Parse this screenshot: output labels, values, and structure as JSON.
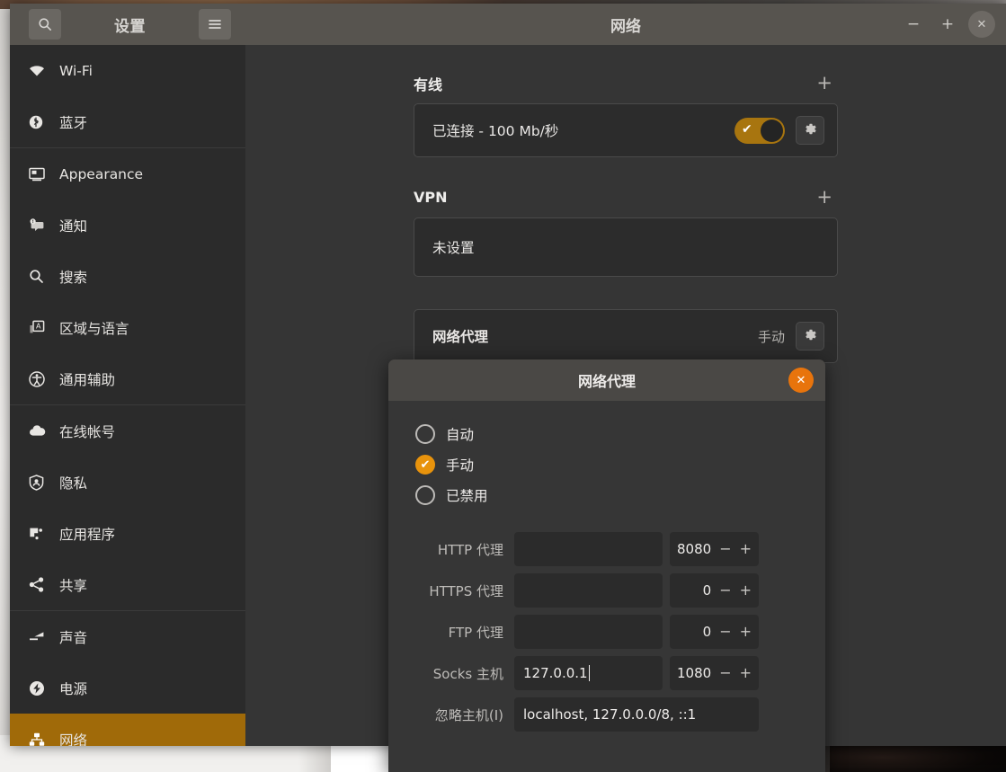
{
  "window": {
    "sidebar_title": "设置",
    "main_title": "网络",
    "search_icon": "search-icon",
    "menu_icon": "hamburger-menu-icon",
    "minimize_label": "−",
    "maximize_label": "+",
    "close_label": "✕"
  },
  "sidebar": {
    "items": [
      {
        "label": "Wi-Fi",
        "icon": "wifi-icon",
        "selected": false
      },
      {
        "label": "蓝牙",
        "icon": "bluetooth-icon",
        "selected": false
      },
      {
        "label": "Appearance",
        "icon": "appearance-icon",
        "selected": false
      },
      {
        "label": "通知",
        "icon": "notifications-icon",
        "selected": false
      },
      {
        "label": "搜索",
        "icon": "search-icon",
        "selected": false
      },
      {
        "label": "区域与语言",
        "icon": "region-language-icon",
        "selected": false
      },
      {
        "label": "通用辅助",
        "icon": "accessibility-icon",
        "selected": false
      },
      {
        "label": "在线帐号",
        "icon": "online-accounts-icon",
        "selected": false
      },
      {
        "label": "隐私",
        "icon": "privacy-icon",
        "selected": false
      },
      {
        "label": "应用程序",
        "icon": "applications-icon",
        "selected": false
      },
      {
        "label": "共享",
        "icon": "sharing-icon",
        "selected": false
      },
      {
        "label": "声音",
        "icon": "sound-icon",
        "selected": false
      },
      {
        "label": "电源",
        "icon": "power-icon",
        "selected": false
      },
      {
        "label": "网络",
        "icon": "network-icon",
        "selected": true
      }
    ]
  },
  "content": {
    "wired": {
      "title": "有线",
      "add_label": "+",
      "status": "已连接 - 100 Mb/秒",
      "toggle_on": true,
      "gear_icon": "gear-icon"
    },
    "vpn": {
      "title": "VPN",
      "add_label": "+",
      "status": "未设置"
    },
    "proxy": {
      "title": "网络代理",
      "value": "手动",
      "gear_icon": "gear-icon"
    }
  },
  "dialog": {
    "title": "网络代理",
    "close_label": "✕",
    "radios": [
      {
        "label": "自动",
        "selected": false
      },
      {
        "label": "手动",
        "selected": true
      },
      {
        "label": "已禁用",
        "selected": false
      }
    ],
    "fields": [
      {
        "label": "HTTP 代理",
        "host": "",
        "port": "8080",
        "minus": "−",
        "plus": "+"
      },
      {
        "label": "HTTPS 代理",
        "host": "",
        "port": "0",
        "minus": "−",
        "plus": "+"
      },
      {
        "label": "FTP 代理",
        "host": "",
        "port": "0",
        "minus": "−",
        "plus": "+"
      },
      {
        "label": "Socks 主机",
        "host": "127.0.0.1",
        "port": "1080",
        "minus": "−",
        "plus": "+"
      }
    ],
    "ignore": {
      "label": "忽略主机(I)",
      "value": "localhost, 127.0.0.0/8, ::1"
    }
  }
}
